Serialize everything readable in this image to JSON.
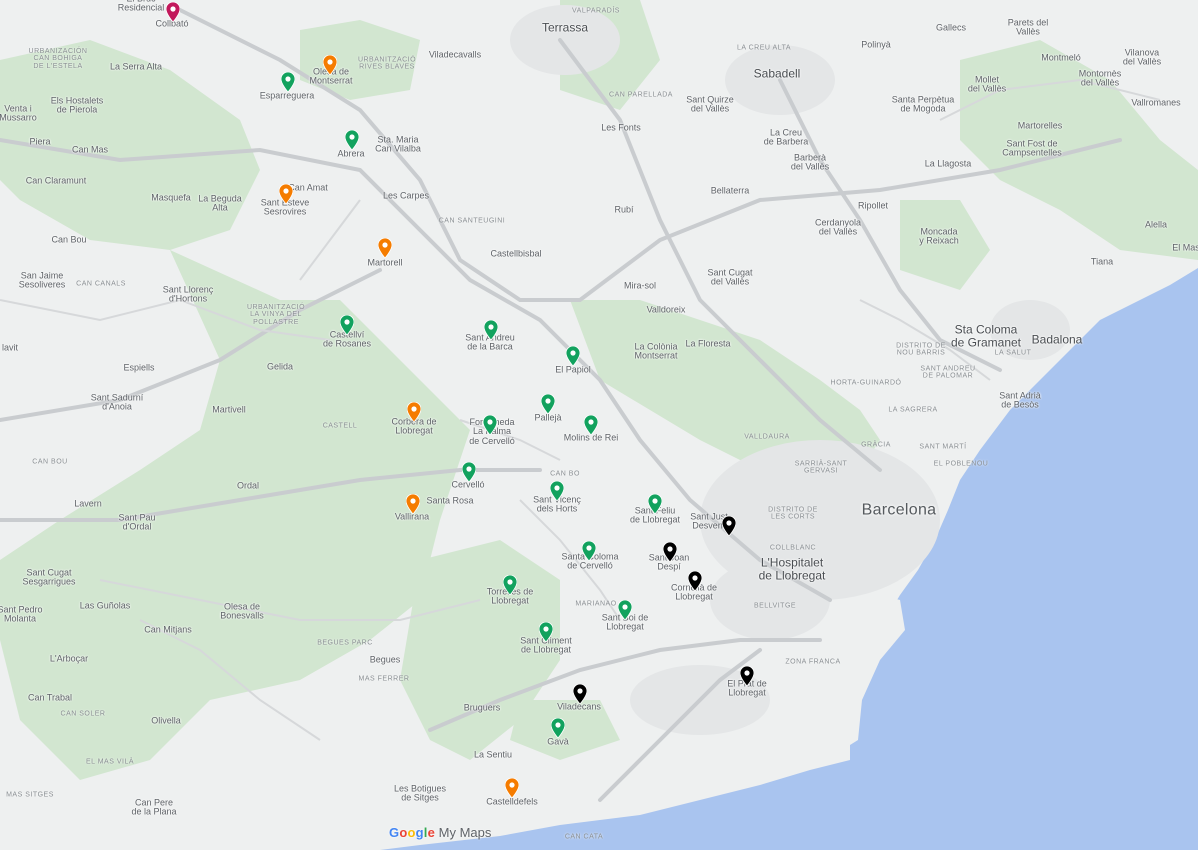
{
  "map": {
    "attribution_brand": "Google",
    "attribution_product": "My Maps",
    "colors": {
      "land": "#eef0f0",
      "forest": "#d2e6d0",
      "sea": "#a9c4ef",
      "highway": "#c9cccf",
      "green_marker": "#12a25e",
      "orange_marker": "#f57c00",
      "black_marker": "#000000",
      "magenta_marker": "#c2185b"
    }
  },
  "labels": {
    "terrassa": "Terrassa",
    "sabadell": "Sabadell",
    "barcelona": "Barcelona",
    "hospitalet": "L'Hospitalet\nde Llobregat",
    "badalona": "Badalona",
    "sta_coloma": "Sta Coloma\nde Gramanet",
    "el_bruc": "El Bruc\nResidencial",
    "collbato": "Collbató",
    "la_serra_alta": "La Serra Alta",
    "els_hostalets": "Els Hostalets\nde Pierola",
    "venta_mussarro": "Venta i\nMussarro",
    "piera": "Piera",
    "can_mas": "Can Mas",
    "can_claramunt": "Can Claramunt",
    "masquefa": "Masquefa",
    "la_beguda": "La Beguda\nAlta",
    "can_bou": "Can Bou",
    "san_jaime": "San Jaime\nSesoliveres",
    "sant_llorenc": "Sant Llorenç\nd'Hortons",
    "clavit": "lavit",
    "espiells": "Espiells",
    "gelida": "Gelida",
    "sant_sadurni": "Sant Sadurní\nd'Anoia",
    "martivell": "Martivell",
    "ordal": "Ordal",
    "lavern": "Lavern",
    "sant_pau": "Sant Pau\nd'Ordal",
    "sant_cugat_sesg": "Sant Cugat\nSesgarrigues",
    "les_gunolas": "Las Guñolas",
    "sant_pedro": "Sant Pedro\nMolanta",
    "can_mitjans": "Can Mitjans",
    "larbocar": "L'Arboçar",
    "olesa_bonesvalls": "Olesa de\nBonesvalls",
    "begues": "Begues",
    "can_trabal": "Can Trabal",
    "olivella": "Olivella",
    "can_pere": "Can Pere\nde la Plana",
    "bruguers": "Bruguers",
    "la_sentiu": "La Sentiu",
    "esparreguera": "Esparreguera",
    "olesa_montserrat": "Olesa de\nMontserrat",
    "abrera": "Abrera",
    "sta_maria_vilalba": "Sta. Maria\nCan Vilalba",
    "les_carpes": "Les Carpes",
    "can_amat": "Can Amat",
    "sant_esteve": "Sant Esteve\nSesrovires",
    "martorell": "Martorell",
    "castellbisbal": "Castellbisbal",
    "castellvi": "Castellví\nde Rosanes",
    "sant_andreu": "Sant Andreu\nde la Barca",
    "el_papiol": "El Papiol",
    "pallejà": "Pallejà",
    "molins": "Molins de Rei",
    "corbera": "Corbera de\nLlobregat",
    "fontrubi": "Fontpineda\nLa Palma\nde Cervelló",
    "cervello": "Cervelló",
    "santa_rosa": "Santa Rosa",
    "vallirana": "Vallirana",
    "sant_vicenc": "Sant Vicenç\ndels Horts",
    "sant_feliu": "Sant Feliu\nde Llobregat",
    "sant_just": "Sant Just\nDesvern",
    "sant_joan_despi": "Sant Joan\nDespí",
    "santa_coloma_cerv": "Santa Coloma\nde Cervelló",
    "cornella": "Cornellà de\nLlobregat",
    "torrelles": "Torrelles de\nLlobregat",
    "sant_boi": "Sant Boi de\nLlobregat",
    "sant_climent": "Sant Climent\nde Llobregat",
    "el_prat": "El Prat de\nLlobregat",
    "viladecans": "Viladecans",
    "gava": "Gavà",
    "castelldefels": "Castelldefels",
    "viladecavalls": "Viladecavalls",
    "rubi": "Rubí",
    "les_fonts": "Les Fonts",
    "bellaterra": "Bellaterra",
    "sant_quirze": "Sant Quirze\ndel Vallès",
    "la_creu": "La Creu\nde Barbera",
    "barbera": "Barberà\ndel Vallès",
    "ripollet": "Ripollet",
    "cerdanyola": "Cerdanyola\ndel Vallès",
    "sant_cugat": "Sant Cugat\ndel Vallès",
    "mira_sol": "Mira-sol",
    "valldoreix": "Valldoreix",
    "la_floresta": "La Floresta",
    "colonia_montserrat": "La Colònia\nMontserrat",
    "polinya": "Polinyà",
    "gallecs": "Gallecs",
    "parets": "Parets del\nVallès",
    "montmelo": "Montmeló",
    "vilanova_valles": "Vilanova\ndel Vallès",
    "montornes": "Montornès\ndel Vallès",
    "mollet": "Mollet\ndel Vallès",
    "vallromanes": "Vallromanes",
    "sta_perpetua": "Santa Perpètua\nde Mogoda",
    "martorelles": "Martorelles",
    "sant_fost": "Sant Fost de\nCampsentelles",
    "la_llagosta": "La Llagosta",
    "montcada": "Moncada\ny Reixach",
    "alella": "Alella",
    "tiana": "Tiana",
    "el_mas": "El Mas",
    "sant_adria": "Sant Adrià\nde Besòs",
    "horta": "HORTA-GUINARDÓ",
    "sant_andreu_pal": "SANT ANDREU\nDE PALOMAR",
    "gracia": "GRÀCIA",
    "sant_marti": "SANT MARTÍ",
    "sarria": "SARRIÀ-SANT\nGERVASI",
    "les_corts": "DISTRITO DE\nLES CORTS",
    "zona_franca": "ZONA FRANCA",
    "valldaura": "VALLDAURA",
    "la_sagrera": "LA SAGRERA",
    "bellvitge": "BELLVITGE",
    "collblanc": "COLLBLANC",
    "can_canals": "CAN CANALS",
    "can_santeugini": "CAN SANTEUGINI",
    "can_parellada": "CAN PARELLADA",
    "la_creu_valles": "LA CREU ALTA",
    "valparadis": "VALPARADÍS",
    "urb_alta": "URBANIZACIÓN\nCAN BOHIGA\nDE L'ESTELA",
    "urb_olesa": "URBANITZACIÓ\nRIVES BLAVES",
    "urb_vinya": "URBANITZACIÓ\nLA VINYA DEL\nPOLLASTRE",
    "can_bou_d": "CAN BOU",
    "can_soler": "CAN SOLER",
    "begues_parc": "BEGUES PARC",
    "mas_ferrer": "MAS FERRER",
    "la_sentiu_d": "EL MAS VILÀ",
    "les_botigues": "Les Botigues\nde Sitges",
    "mas_sitges": "MAS SITGES",
    "marianao": "MARIANAO",
    "can_bo": "CAN BO",
    "district_sentmenat": "DISTRITO DE\nNOU BARRIS",
    "sant_joan_nou": "LA SALUT",
    "coll_de_la": "EL POBLENOU",
    "el_castell": "CASTELL",
    "ca_n_cata": "CAN CATA"
  },
  "markers": [
    {
      "name": "Collbató",
      "color": "magenta",
      "lat_lng_shown": false
    },
    {
      "name": "Olesa de Montserrat",
      "color": "orange"
    },
    {
      "name": "Esparreguera",
      "color": "green"
    },
    {
      "name": "Abrera",
      "color": "green"
    },
    {
      "name": "Sant Esteve Sesrovires",
      "color": "orange"
    },
    {
      "name": "Martorell",
      "color": "orange"
    },
    {
      "name": "Castellví de Rosanes",
      "color": "green"
    },
    {
      "name": "Sant Andreu de la Barca",
      "color": "green"
    },
    {
      "name": "El Papiol",
      "color": "green"
    },
    {
      "name": "Pallejà",
      "color": "green"
    },
    {
      "name": "Molins de Rei",
      "color": "green"
    },
    {
      "name": "Corbera de Llobregat",
      "color": "orange"
    },
    {
      "name": "La Palma de Cervelló",
      "color": "green"
    },
    {
      "name": "Cervelló",
      "color": "green"
    },
    {
      "name": "Vallirana",
      "color": "orange"
    },
    {
      "name": "Sant Vicenç dels Horts",
      "color": "green"
    },
    {
      "name": "Sant Feliu de Llobregat",
      "color": "green"
    },
    {
      "name": "Sant Just Desvern",
      "color": "black"
    },
    {
      "name": "Sant Joan Despí",
      "color": "black"
    },
    {
      "name": "Santa Coloma de Cervelló",
      "color": "green"
    },
    {
      "name": "Cornellà de Llobregat",
      "color": "black"
    },
    {
      "name": "Torrelles de Llobregat",
      "color": "green"
    },
    {
      "name": "Sant Boi de Llobregat",
      "color": "green"
    },
    {
      "name": "Sant Climent de Llobregat",
      "color": "green"
    },
    {
      "name": "El Prat de Llobregat",
      "color": "black"
    },
    {
      "name": "Viladecans",
      "color": "black"
    },
    {
      "name": "Gavà",
      "color": "green"
    },
    {
      "name": "Castelldefels",
      "color": "orange"
    }
  ]
}
